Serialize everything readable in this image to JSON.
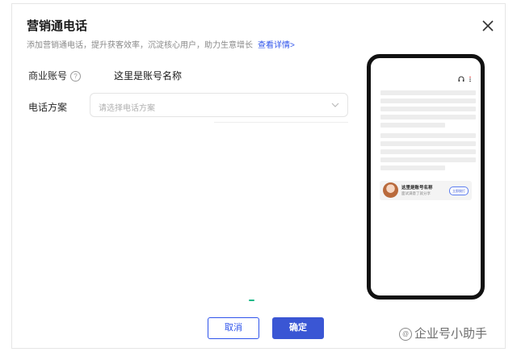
{
  "dialog": {
    "title": "营销通电话",
    "subtitle": "添加营销通电话，提升获客效率，沉淀核心用户，助力生意增长",
    "details_link": "查看详情>",
    "close_icon": "close-icon"
  },
  "form": {
    "account_label": "商业账号",
    "account_help_icon": "question-circle-icon",
    "account_value": "这里是账号名称",
    "plan_label": "电话方案",
    "plan_placeholder": "请选择电话方案"
  },
  "buttons": {
    "cancel": "取消",
    "confirm": "确定"
  },
  "preview": {
    "card_name": "这里是账号名称",
    "card_sub": "面试满意了就分享",
    "card_button": "立即拨打"
  },
  "watermark": {
    "text": "企业号小助手"
  },
  "colors": {
    "accent": "#3a56d4",
    "link": "#2f54eb",
    "border": "#e4e4e4"
  }
}
